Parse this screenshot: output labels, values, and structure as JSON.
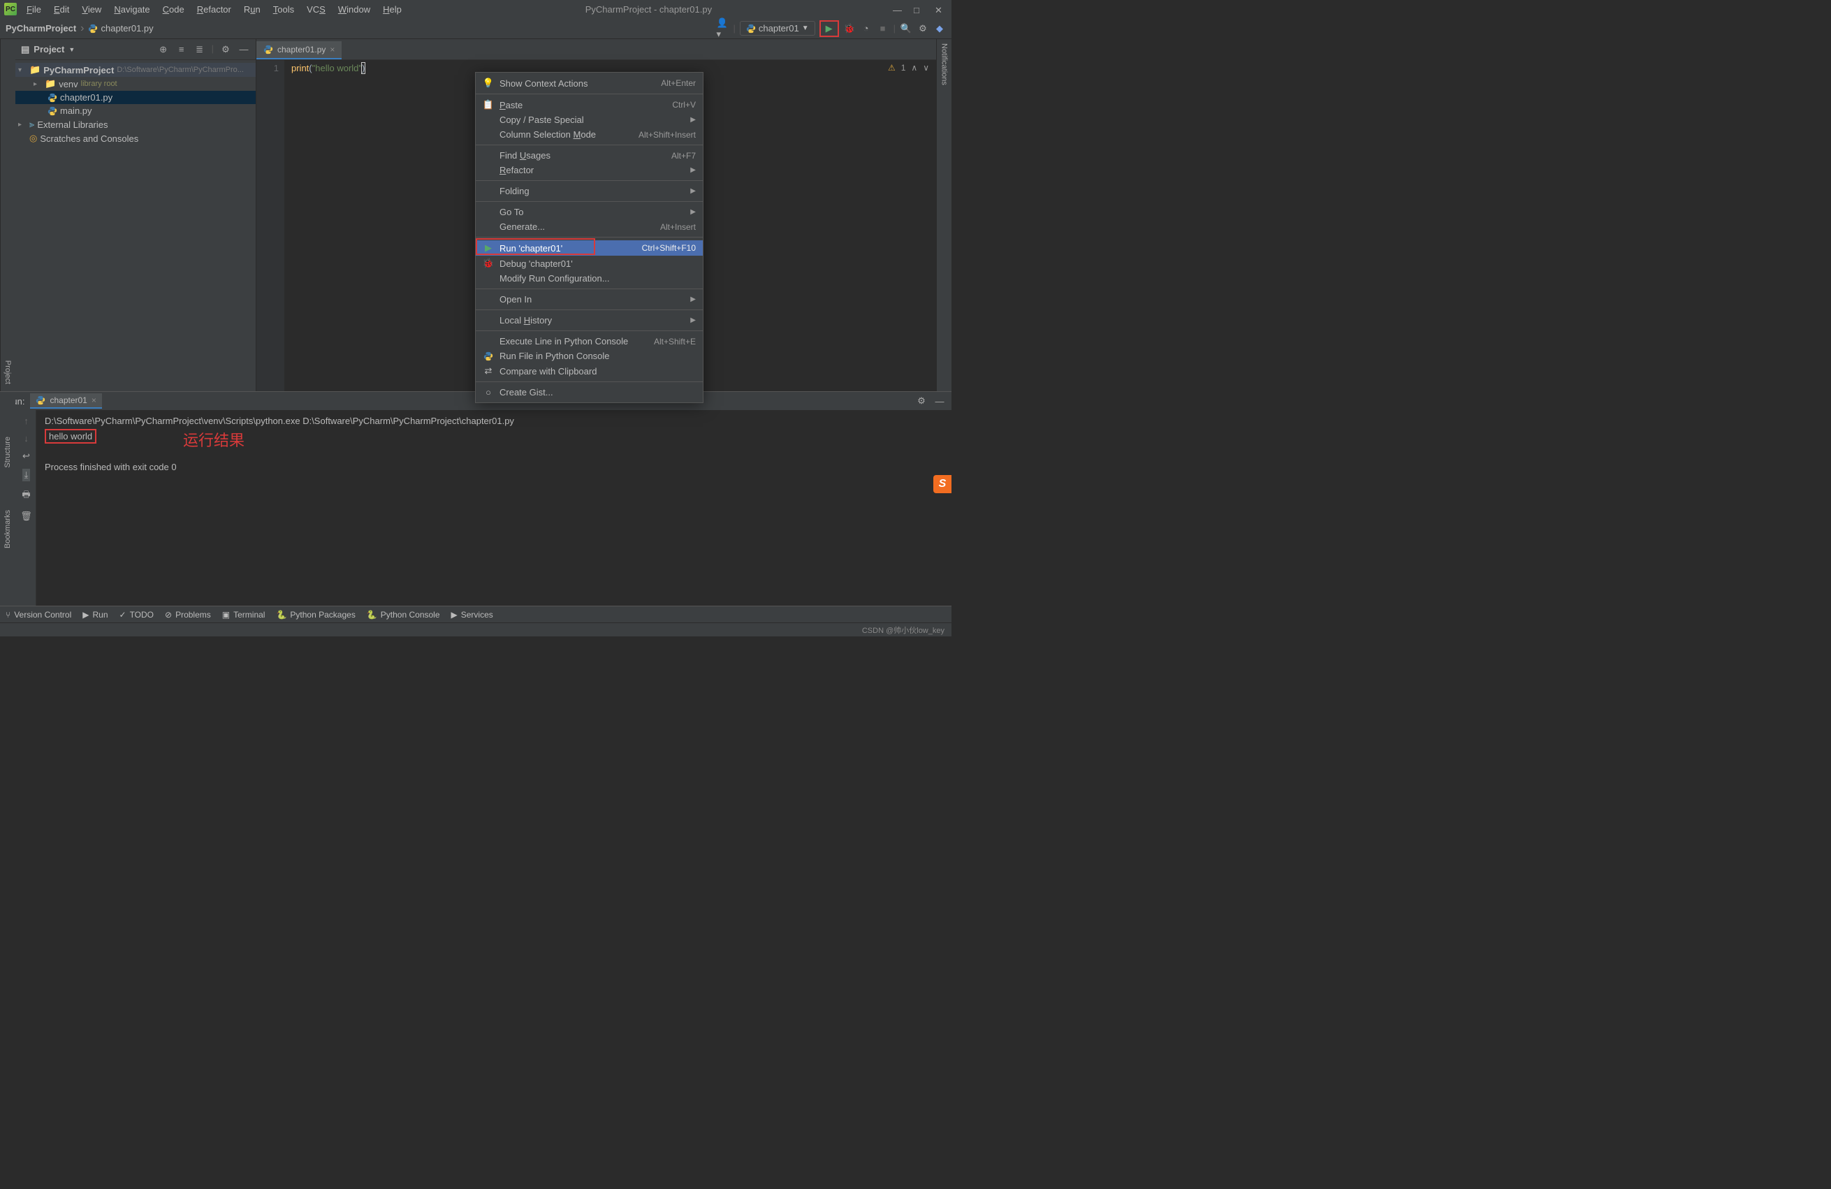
{
  "window": {
    "title": "PyCharmProject - chapter01.py"
  },
  "menu": [
    "File",
    "Edit",
    "View",
    "Navigate",
    "Code",
    "Refactor",
    "Run",
    "Tools",
    "VCS",
    "Window",
    "Help"
  ],
  "breadcrumb": {
    "project": "PyCharmProject",
    "file": "chapter01.py"
  },
  "run_config": {
    "name": "chapter01"
  },
  "project_panel": {
    "title": "Project",
    "tree": {
      "root": "PyCharmProject",
      "root_path": "D:\\Software\\PyCharm\\PyCharmPro...",
      "venv": "venv",
      "venv_label": "library root",
      "file1": "chapter01.py",
      "file2": "main.py",
      "ext_lib": "External Libraries",
      "scratches": "Scratches and Consoles"
    }
  },
  "editor": {
    "tab": "chapter01.py",
    "line_no": "1",
    "code_fn": "print",
    "code_str": "\"hello world\"",
    "warnings": "1"
  },
  "context_menu": {
    "show_context": "Show Context Actions",
    "show_context_sc": "Alt+Enter",
    "paste": "Paste",
    "paste_sc": "Ctrl+V",
    "copy_paste": "Copy / Paste Special",
    "col_sel": "Column Selection Mode",
    "col_sel_sc": "Alt+Shift+Insert",
    "find_usages": "Find Usages",
    "find_usages_sc": "Alt+F7",
    "refactor": "Refactor",
    "folding": "Folding",
    "goto": "Go To",
    "generate": "Generate...",
    "generate_sc": "Alt+Insert",
    "run": "Run 'chapter01'",
    "run_sc": "Ctrl+Shift+F10",
    "debug": "Debug 'chapter01'",
    "modify": "Modify Run Configuration...",
    "open_in": "Open In",
    "local_hist": "Local History",
    "exec_line": "Execute Line in Python Console",
    "exec_line_sc": "Alt+Shift+E",
    "run_file": "Run File in Python Console",
    "compare": "Compare with Clipboard",
    "gist": "Create Gist..."
  },
  "run_panel": {
    "label": "Run:",
    "tab": "chapter01",
    "line1": "D:\\Software\\PyCharm\\PyCharmProject\\venv\\Scripts\\python.exe D:\\Software\\PyCharm\\PyCharmProject\\chapter01.py",
    "output": "hello world",
    "exit": "Process finished with exit code 0"
  },
  "annotation": "运行结果",
  "bottom_tabs": {
    "vcs": "Version Control",
    "run": "Run",
    "todo": "TODO",
    "problems": "Problems",
    "terminal": "Terminal",
    "pkgs": "Python Packages",
    "pyconsole": "Python Console",
    "services": "Services"
  },
  "left_tabs": {
    "structure": "Structure",
    "bookmarks": "Bookmarks",
    "project": "Project"
  },
  "right_tabs": {
    "notifications": "Notifications"
  },
  "status": {
    "csdn": "CSDN @帅小伙low_key"
  }
}
